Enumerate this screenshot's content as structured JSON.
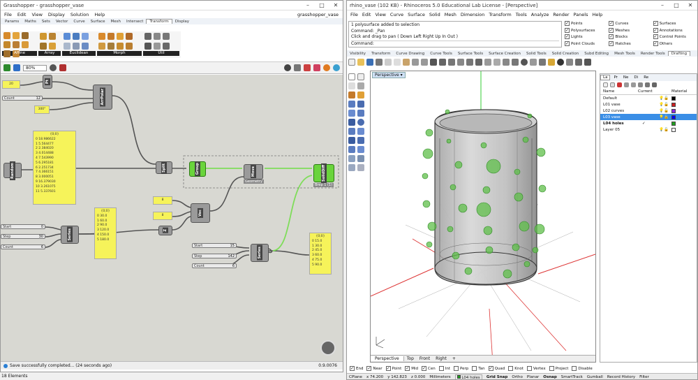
{
  "gh": {
    "title": "Grasshopper - grasshopper_vase",
    "doc_name": "grasshopper_vase",
    "menu": [
      "File",
      "Edit",
      "View",
      "Display",
      "Solution",
      "Help"
    ],
    "tabs": [
      "Params",
      "Maths",
      "Sets",
      "Vector",
      "Curve",
      "Surface",
      "Mesh",
      "Intersect",
      "Transform",
      "Display"
    ],
    "active_tab": "Transform",
    "groups": [
      "Affine",
      "Array",
      "Euclidean",
      "Morph",
      "Util"
    ],
    "zoom": "80%",
    "status": "Save successfully completed... (24 seconds ago)",
    "version": "0.9.0076",
    "elements_count": "18 Elements",
    "nodes": {
      "pt": "Pt",
      "arrpolar": "ArrPolar",
      "random": "Random",
      "split": "Split",
      "group": "Group",
      "move": "Move",
      "vec": "Vec",
      "series1": "Series",
      "series2": "Series",
      "solid": "SolidDiff",
      "z": "Z"
    },
    "sliders": {
      "count_top": {
        "name": "Count",
        "value": "12"
      },
      "s1": {
        "name": "Start",
        "value": "0"
      },
      "s2": {
        "name": "Step",
        "value": "30"
      },
      "s3": {
        "name": "Count",
        "value": "6"
      },
      "s4": {
        "name": "Start",
        "value": "15"
      },
      "s5": {
        "name": "Step",
        "value": "142"
      },
      "s6": {
        "name": "Count",
        "value": "6"
      }
    },
    "small_panels": {
      "p1": "20",
      "p2": "300°",
      "p3": "8",
      "p4": "8",
      "p5": "0"
    },
    "panel_a": {
      "head": "{0;0}",
      "rows": [
        "0 18.986622",
        "1 5.564477",
        "2 2.384020",
        "3 4.014488",
        "4 7.543990",
        "5 6.295181",
        "6 2.251734",
        "7 4.366151",
        "8 3.000051",
        "9 16.379030",
        "10 3.261075",
        "11 5.337601"
      ]
    },
    "panel_b": {
      "head": "{0;0}",
      "rows": [
        "0 30.0",
        "1 60.0",
        "2 90.0",
        "3 120.0",
        "4 150.0",
        "5 180.0"
      ]
    },
    "panel_c": {
      "head": "{0;0}",
      "rows": [
        "0 15.0",
        "1 30.0",
        "2 45.0",
        "3 60.0",
        "4 75.0",
        "5 90.0"
      ]
    },
    "move_tip": "Geometry",
    "solid_tip": "Brep 1 (1)"
  },
  "rh": {
    "title": "rhino_vase (102 KB) - Rhinoceros 5.0 Educational Lab License - [Perspective]",
    "menu": [
      "File",
      "Edit",
      "View",
      "Curve",
      "Surface",
      "Solid",
      "Mesh",
      "Dimension",
      "Transform",
      "Tools",
      "Analyze",
      "Render",
      "Panels",
      "Help"
    ],
    "cmd_history": [
      "1 polysurface added to selection",
      "Command: _Pan",
      "Click and drag to pan ( Down Left Right Up In Out )"
    ],
    "cmd_prompt": "Command:",
    "filters": [
      [
        "Points",
        "Curves",
        "Surfaces"
      ],
      [
        "Polysurfaces",
        "Meshes",
        "Annotations"
      ],
      [
        "Lights",
        "Blocks",
        "Control Points"
      ],
      [
        "Point Clouds",
        "Hatches",
        "Others"
      ]
    ],
    "toolbar_tabs": [
      "Visibility",
      "Transform",
      "Curve Drawing",
      "Curve Tools",
      "Surface Tools",
      "Surface Creation",
      "Solid Tools",
      "Solid Creation",
      "Subd Editing",
      "Mesh Tools",
      "Render Tools",
      "Drafting"
    ],
    "viewport_label": "Perspective",
    "view_tabs": [
      "Perspective",
      "Top",
      "Front",
      "Right"
    ],
    "panel_tabs": [
      "La",
      "Pr",
      "Ne",
      "Di",
      "Re"
    ],
    "layers_header": [
      "Name",
      "Current",
      "Material"
    ],
    "layers": [
      {
        "name": "Default",
        "current": false,
        "color": "#000000"
      },
      {
        "name": "L01 vase",
        "current": false,
        "color": "#cc2020"
      },
      {
        "name": "L02 curves",
        "current": false,
        "color": "#8a2be2"
      },
      {
        "name": "L03 vase",
        "current": false,
        "color": "#0000ff",
        "selected": true
      },
      {
        "name": "L04 holes",
        "current": true,
        "color": "#20a020",
        "bold": true
      },
      {
        "name": "Layer 05",
        "current": false,
        "color": "#ffffff"
      }
    ],
    "osnaps": [
      "End",
      "Near",
      "Point",
      "Mid",
      "Cen",
      "Int",
      "Perp",
      "Tan",
      "Quad",
      "Knot",
      "Vertex",
      "Project",
      "Disable"
    ],
    "status": {
      "cplane": "CPlane",
      "x": "x 74.200",
      "y": "y 142.823",
      "z": "z 0.000",
      "units": "Millimeters",
      "layer": "L04 holes",
      "toggles": [
        "Grid Snap",
        "Ortho",
        "Planar",
        "Osnap",
        "SmartTrack",
        "Gumball",
        "Record History",
        "Filter"
      ]
    }
  },
  "colors": {
    "accent": "#3a8ee6",
    "gh_canvas": "#d8d8d2",
    "panel": "#f6f35a",
    "node_green": "#6ad43c"
  }
}
